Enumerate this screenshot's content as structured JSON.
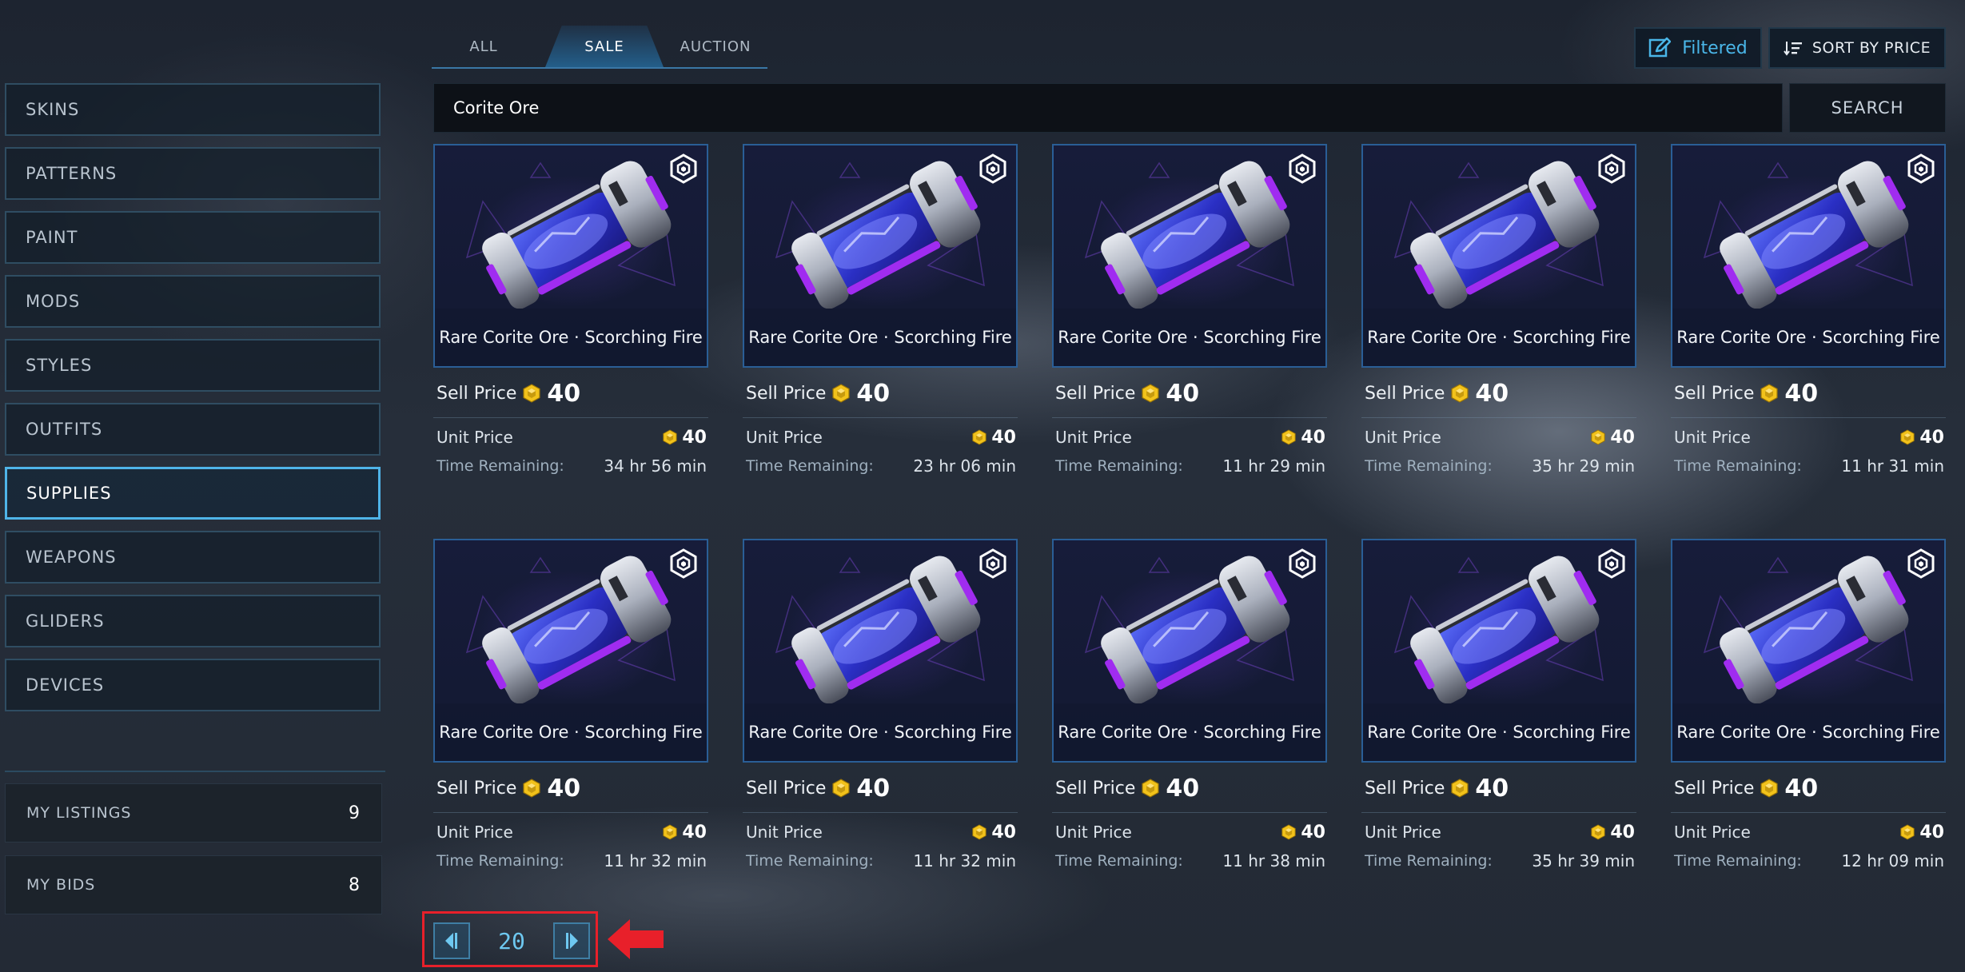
{
  "colors": {
    "accent": "#4ab6e8",
    "card_border": "#2a5e96",
    "highlight_red": "#e8202a",
    "coin_gold": "#f2c21b",
    "capsule_purple": "#a02cf0"
  },
  "tabs": [
    {
      "label": "ALL",
      "active": false
    },
    {
      "label": "SALE",
      "active": true
    },
    {
      "label": "AUCTION",
      "active": false
    }
  ],
  "toolbar": {
    "filtered_label": "Filtered",
    "filtered_icon": "edit-icon",
    "sort_label": "SORT BY PRICE",
    "sort_icon": "sort-icon"
  },
  "search": {
    "value": "Corite Ore",
    "button_label": "SEARCH"
  },
  "sidebar": {
    "categories": [
      {
        "label": "SKINS",
        "active": false
      },
      {
        "label": "PATTERNS",
        "active": false
      },
      {
        "label": "PAINT",
        "active": false
      },
      {
        "label": "MODS",
        "active": false
      },
      {
        "label": "STYLES",
        "active": false
      },
      {
        "label": "OUTFITS",
        "active": false
      },
      {
        "label": "SUPPLIES",
        "active": true
      },
      {
        "label": "WEAPONS",
        "active": false
      },
      {
        "label": "GLIDERS",
        "active": false
      },
      {
        "label": "DEVICES",
        "active": false
      }
    ],
    "my_listings": {
      "label": "MY LISTINGS",
      "count": "9"
    },
    "my_bids": {
      "label": "MY BIDS",
      "count": "8"
    }
  },
  "listing_labels": {
    "sell_price": "Sell Price",
    "unit_price": "Unit Price",
    "time_remaining": "Time Remaining:"
  },
  "listings": [
    {
      "name": "Rare Corite Ore · Scorching Fire",
      "sell_price": "40",
      "unit_price": "40",
      "time_remaining": "34 hr 56 min"
    },
    {
      "name": "Rare Corite Ore · Scorching Fire",
      "sell_price": "40",
      "unit_price": "40",
      "time_remaining": "23 hr 06 min"
    },
    {
      "name": "Rare Corite Ore · Scorching Fire",
      "sell_price": "40",
      "unit_price": "40",
      "time_remaining": "11 hr 29 min"
    },
    {
      "name": "Rare Corite Ore · Scorching Fire",
      "sell_price": "40",
      "unit_price": "40",
      "time_remaining": "35 hr 29 min"
    },
    {
      "name": "Rare Corite Ore · Scorching Fire",
      "sell_price": "40",
      "unit_price": "40",
      "time_remaining": "11 hr 31 min"
    },
    {
      "name": "Rare Corite Ore · Scorching Fire",
      "sell_price": "40",
      "unit_price": "40",
      "time_remaining": "11 hr 32 min"
    },
    {
      "name": "Rare Corite Ore · Scorching Fire",
      "sell_price": "40",
      "unit_price": "40",
      "time_remaining": "11 hr 32 min"
    },
    {
      "name": "Rare Corite Ore · Scorching Fire",
      "sell_price": "40",
      "unit_price": "40",
      "time_remaining": "11 hr 38 min"
    },
    {
      "name": "Rare Corite Ore · Scorching Fire",
      "sell_price": "40",
      "unit_price": "40",
      "time_remaining": "35 hr 39 min"
    },
    {
      "name": "Rare Corite Ore · Scorching Fire",
      "sell_price": "40",
      "unit_price": "40",
      "time_remaining": "12 hr 09 min"
    }
  ],
  "pagination": {
    "page": "20",
    "prev_icon": "triangle-left-icon",
    "next_icon": "triangle-right-icon"
  }
}
